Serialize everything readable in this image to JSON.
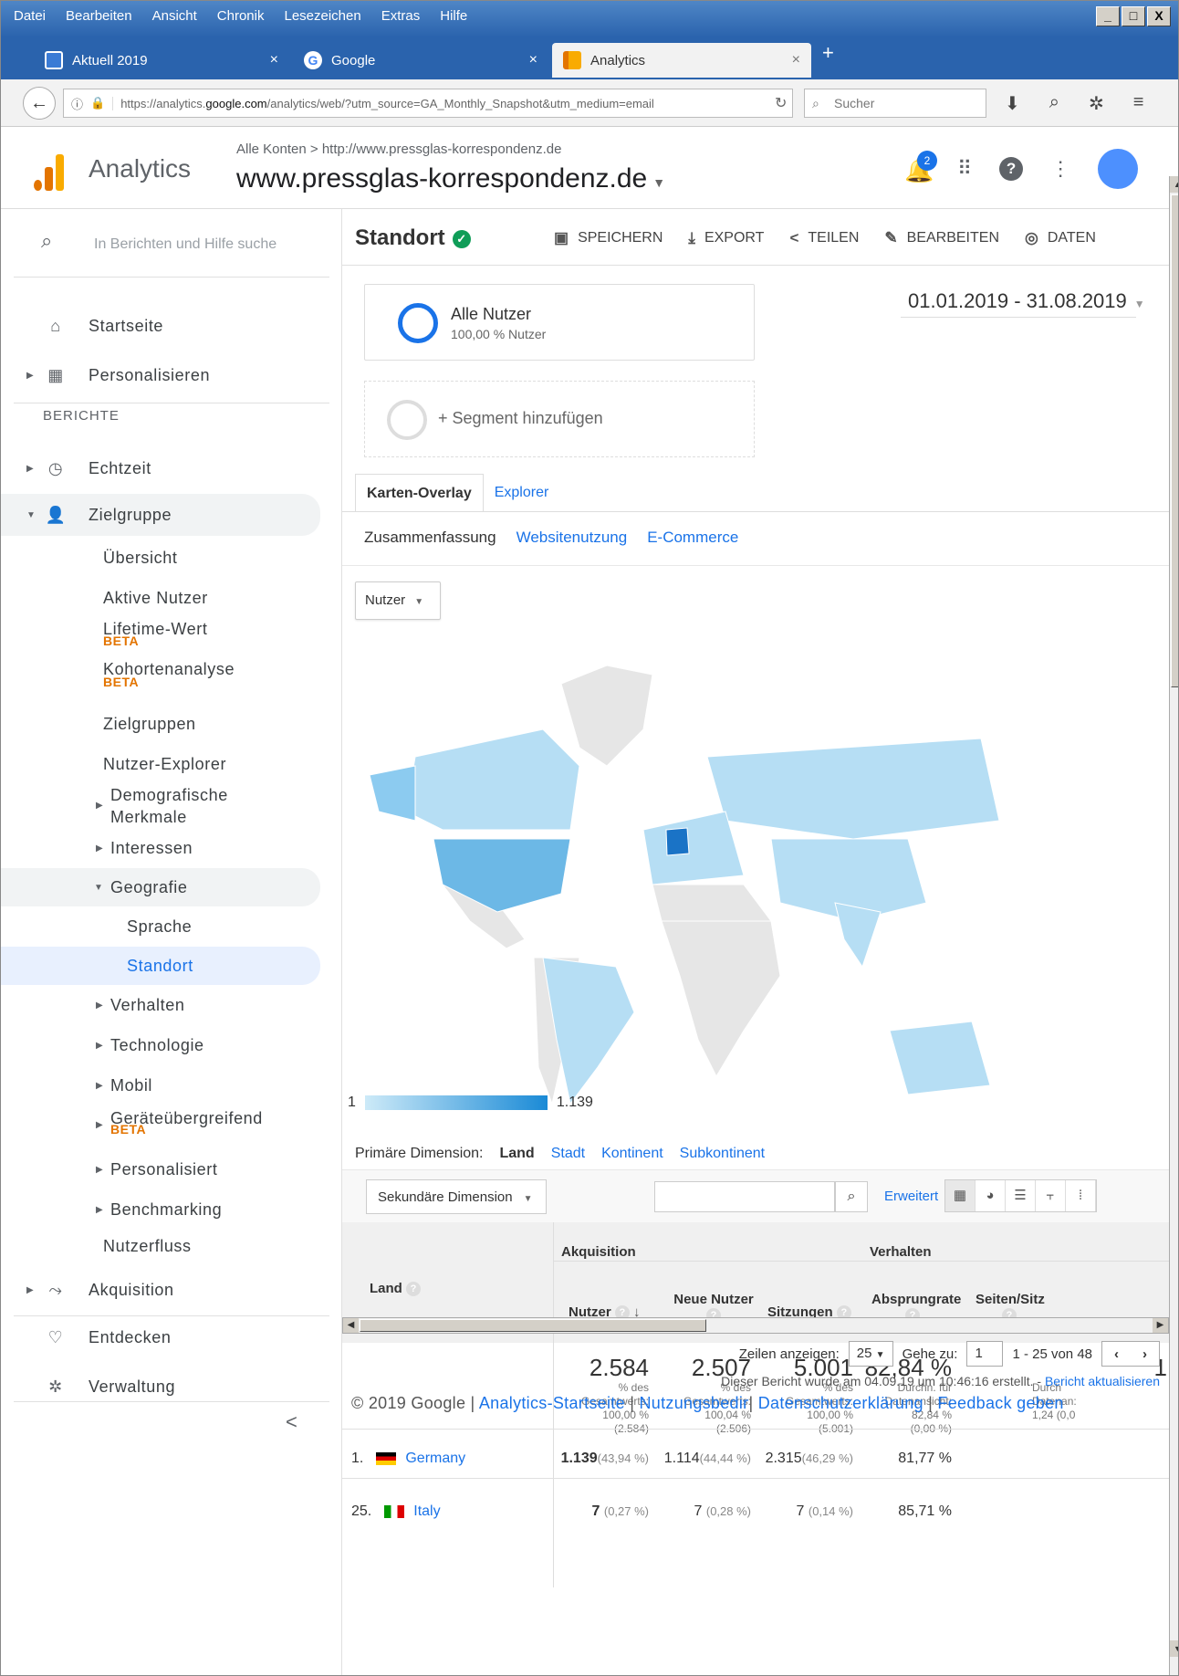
{
  "browser": {
    "menu": [
      "Datei",
      "Bearbeiten",
      "Ansicht",
      "Chronik",
      "Lesezeichen",
      "Extras",
      "Hilfe"
    ],
    "tabs": [
      {
        "label": "Aktuell 2019",
        "close": "×"
      },
      {
        "label": "Google",
        "close": "×"
      },
      {
        "label": "Analytics",
        "close": "×"
      }
    ],
    "new_tab": "+",
    "url_prefix": "https://analytics.",
    "url_host": "google.com",
    "url_rest": "/analytics/web/?utm_source=GA_Monthly_Snapshot&utm_medium=email",
    "search_placeholder": "Sucher",
    "window_buttons": [
      "_",
      "□",
      "X"
    ]
  },
  "header": {
    "product": "Analytics",
    "breadcrumb": "Alle Konten > http://www.pressglas-korrespondenz.de",
    "property": "www.pressglas-korrespondenz.de",
    "notification_count": "2"
  },
  "sidebar": {
    "search_placeholder": "In Berichten und Hilfe suche",
    "home": "Startseite",
    "customize": "Personalisieren",
    "reports_header": "BERICHTE",
    "realtime": "Echtzeit",
    "audience": "Zielgruppe",
    "audience_items": {
      "overview": "Übersicht",
      "active": "Aktive Nutzer",
      "lifetime": "Lifetime-Wert",
      "cohort": "Kohortenanalyse",
      "audiences": "Zielgruppen",
      "explorer": "Nutzer-Explorer",
      "demo1": "Demografische",
      "demo2": "Merkmale",
      "interests": "Interessen",
      "geo": "Geografie",
      "language": "Sprache",
      "location": "Standort",
      "behavior": "Verhalten",
      "technology": "Technologie",
      "mobile": "Mobil",
      "crossdevice": "Geräteübergreifend",
      "custom": "Personalisiert",
      "benchmarking": "Benchmarking",
      "flow": "Nutzerfluss"
    },
    "beta": "BETA",
    "acquisition": "Akquisition",
    "discover": "Entdecken",
    "admin": "Verwaltung",
    "collapse": "<"
  },
  "report": {
    "title": "Standort",
    "actions": {
      "save": "SPEICHERN",
      "export": "EXPORT",
      "share": "TEILEN",
      "edit": "BEARBEITEN",
      "data": "DATEN"
    },
    "segment_name": "Alle Nutzer",
    "segment_sub": "100,00 % Nutzer",
    "segment_add": "+ Segment hinzufügen",
    "date_range": "01.01.2019 - 31.08.2019",
    "tabs": [
      "Karten-Overlay",
      "Explorer"
    ],
    "subtabs": [
      "Zusammenfassung",
      "Websitenutzung",
      "E-Commerce"
    ],
    "metric": "Nutzer",
    "legend_min": "1",
    "legend_max": "1.139",
    "primary_dim_label": "Primäre Dimension:",
    "primary_dims": [
      "Land",
      "Stadt",
      "Kontinent",
      "Subkontinent"
    ],
    "secondary_dim": "Sekundäre Dimension",
    "advanced": "Erweitert"
  },
  "table": {
    "group_acq": "Akquisition",
    "group_beh": "Verhalten",
    "col_country": "Land",
    "cols": [
      "Nutzer",
      "Neue Nutzer",
      "Sitzungen",
      "Absprungrate",
      "Seiten/Sitz"
    ],
    "totals": [
      {
        "value": "2.584",
        "l1": "% des",
        "l2": "Gesamtwerts:",
        "l3": "100,00 %",
        "l4": "(2.584)"
      },
      {
        "value": "2.507",
        "l1": "% des",
        "l2": "Gesamtwerts:",
        "l3": "100,04 %",
        "l4": "(2.506)"
      },
      {
        "value": "5.001",
        "l1": "% des",
        "l2": "Gesamtwerts:",
        "l3": "100,00 %",
        "l4": "(5.001)"
      },
      {
        "value": "82,84 %",
        "l1": "Durchn. für",
        "l2": "Datenansicht:",
        "l3": "82,84 %",
        "l4": "(0,00 %)"
      },
      {
        "value": "1",
        "l1": "Durch",
        "l2": "Datenan:",
        "l3": "1,24 (0,0",
        "l4": ""
      }
    ],
    "rows": [
      {
        "rank": "1.",
        "country": "Germany",
        "users": "1.139",
        "users_pct": "(43,94 %)",
        "new": "1.114",
        "new_pct": "(44,44 %)",
        "sess": "2.315",
        "sess_pct": "(46,29 %)",
        "bounce": "81,77 %"
      },
      {
        "rank": "25.",
        "country": "Italy",
        "users": "7",
        "users_pct": "(0,27 %)",
        "new": "7",
        "new_pct": "(0,28 %)",
        "sess": "7",
        "sess_pct": "(0,14 %)",
        "bounce": "85,71 %"
      }
    ]
  },
  "pager": {
    "rows_label": "Zeilen anzeigen:",
    "rows_value": "25",
    "goto_label": "Gehe zu:",
    "goto_value": "1",
    "range": "1 - 25 von 48"
  },
  "created": "Dieser Bericht wurde am 04.09.19 um 10:46:16 erstellt. - ",
  "refresh": "Bericht aktualisieren",
  "footer": {
    "copy": "© 2019 Google | ",
    "links": [
      "Analytics-Startseite",
      "Nutzungsbedir",
      "Datenschutzerklärung",
      "Feedback geben"
    ]
  },
  "colors": {
    "accent": "#1a73e8",
    "ga_orange": "#e37400",
    "map_high": "#1a8ad6",
    "map_low": "#cdeaf8"
  }
}
